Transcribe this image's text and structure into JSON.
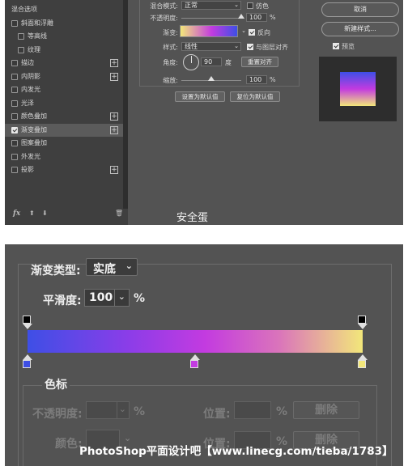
{
  "top_panel": {
    "effects_list": {
      "items": [
        {
          "label": "混合选项",
          "checkbox": false,
          "plus": false,
          "selected": false
        },
        {
          "label": "斜面和浮雕",
          "checkbox": true,
          "checked": false,
          "plus": false,
          "selected": false
        },
        {
          "label": "等高线",
          "checkbox": true,
          "checked": false,
          "plus": false,
          "selected": false,
          "indent": true
        },
        {
          "label": "纹理",
          "checkbox": true,
          "checked": false,
          "plus": false,
          "selected": false,
          "indent": true
        },
        {
          "label": "描边",
          "checkbox": true,
          "checked": false,
          "plus": true,
          "selected": false
        },
        {
          "label": "内阴影",
          "checkbox": true,
          "checked": false,
          "plus": true,
          "selected": false
        },
        {
          "label": "内发光",
          "checkbox": true,
          "checked": false,
          "plus": false,
          "selected": false
        },
        {
          "label": "光泽",
          "checkbox": true,
          "checked": false,
          "plus": false,
          "selected": false
        },
        {
          "label": "颜色叠加",
          "checkbox": true,
          "checked": false,
          "plus": true,
          "selected": false
        },
        {
          "label": "渐变叠加",
          "checkbox": true,
          "checked": true,
          "plus": true,
          "selected": true
        },
        {
          "label": "图案叠加",
          "checkbox": true,
          "checked": false,
          "plus": false,
          "selected": false
        },
        {
          "label": "外发光",
          "checkbox": true,
          "checked": false,
          "plus": false,
          "selected": false
        },
        {
          "label": "投影",
          "checkbox": true,
          "checked": false,
          "plus": true,
          "selected": false
        }
      ],
      "footer": {
        "fx": "fx",
        "up": "⬆",
        "down": "⬇",
        "trash": "🗑"
      }
    },
    "gradient_overlay": {
      "blend_mode_label": "混合模式:",
      "blend_mode_value": "正常",
      "dither_label": "仿色",
      "opacity_label": "不透明度:",
      "opacity_value": "100",
      "opacity_unit": "%",
      "opacity_level": 1.0,
      "gradient_label": "渐变:",
      "reverse_label": "反向",
      "reverse_checked": true,
      "style_label": "样式:",
      "style_value": "线性",
      "align_label": "与图层对齐",
      "align_checked": true,
      "angle_label": "角度:",
      "angle_value": "90",
      "angle_unit": "度",
      "reset_align_label": "重置对齐",
      "scale_label": "缩放:",
      "scale_value": "100",
      "scale_unit": "%",
      "scale_level": 0.5,
      "set_default_label": "设置为默认值",
      "reset_default_label": "复位为默认值"
    },
    "right_buttons": {
      "cancel_label": "取消",
      "new_style_label": "新建样式...",
      "preview_label": "预览",
      "preview_checked": true
    },
    "watermark": "安全蛋"
  },
  "bottom_panel": {
    "gradient_type_label": "渐变类型:",
    "gradient_type_value": "实底",
    "smoothness_label": "平滑度:",
    "smoothness_value": "100",
    "smoothness_unit": "%",
    "opacity_stops": [
      {
        "position": 0,
        "color": "#000000"
      },
      {
        "position": 100,
        "color": "#000000"
      }
    ],
    "color_stops": [
      {
        "position": 0,
        "color": "#3e4fe6"
      },
      {
        "position": 50,
        "color": "#c33be0"
      },
      {
        "position": 100,
        "color": "#f2e77a"
      }
    ],
    "stops_group_label": "色标",
    "stop_opacity_label": "不透明度:",
    "stop_opacity_unit": "%",
    "location_label_1": "位置:",
    "location_unit_1": "%",
    "delete_label_1": "删除",
    "color_label": "颜色:",
    "location_label_2": "位置:",
    "location_unit_2": "%",
    "delete_label_2": "删除",
    "watermark": "PhotoShop平面设计吧【www.linecg.com/tieba/1783】"
  }
}
